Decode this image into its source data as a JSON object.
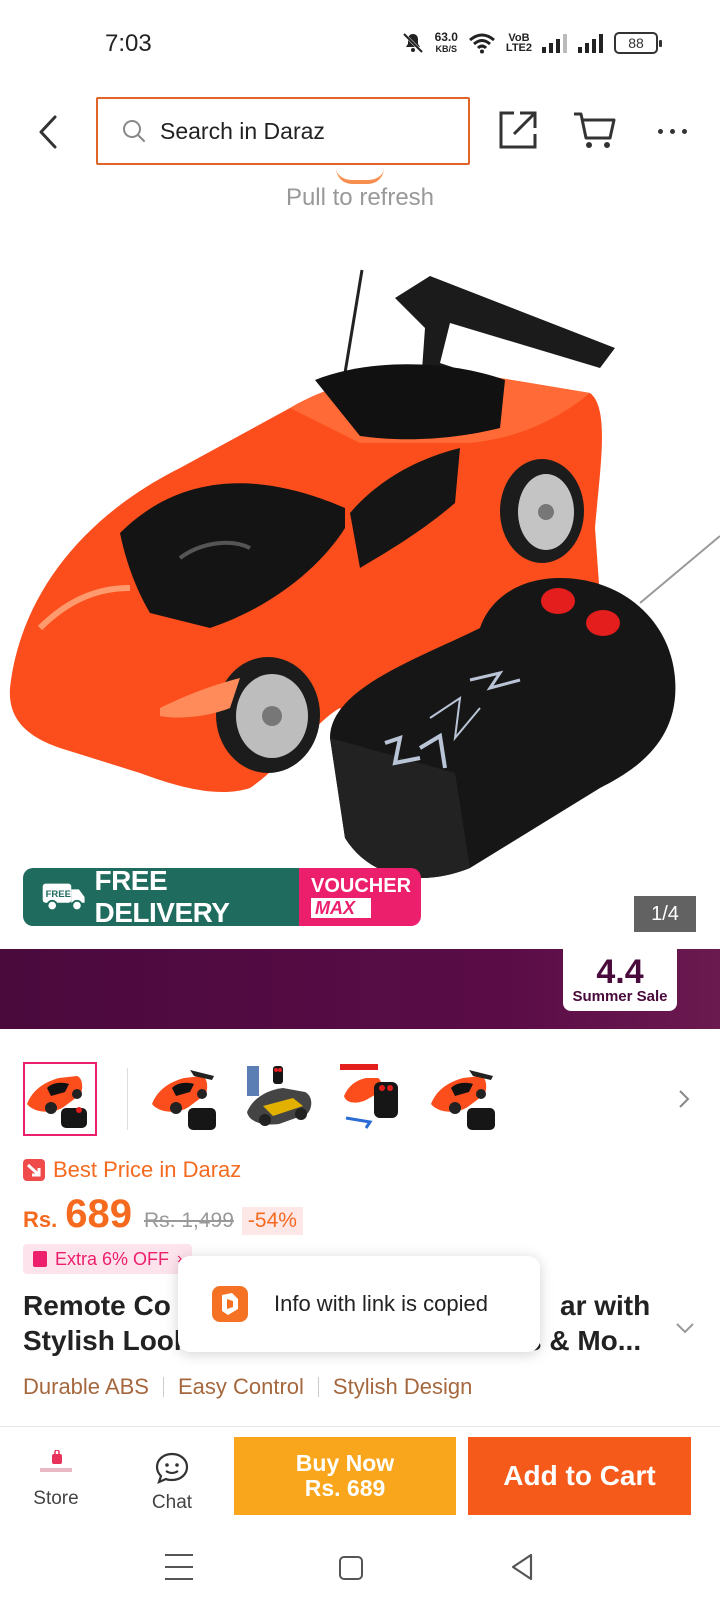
{
  "status_bar": {
    "time": "7:03",
    "net_speed_value": "63.0",
    "net_speed_unit": "KB/S",
    "volte_top": "VoB",
    "volte_bottom": "LTE2",
    "battery": "88"
  },
  "header": {
    "search_placeholder": "Search in Daraz"
  },
  "pull_to_refresh": "Pull to refresh",
  "gallery": {
    "counter": "1/4",
    "promo_free_icon_text": "FREE",
    "promo_free_label": "FREE DELIVERY",
    "promo_voucher_top": "VOUCHER",
    "promo_voucher_bottom": "MAX"
  },
  "campaign": {
    "badge_big": "4.4",
    "badge_small": "Summer Sale"
  },
  "price": {
    "best_price_label": "Best Price in Daraz",
    "currency": "Rs.",
    "amount": "689",
    "original": "Rs. 1,499",
    "discount": "-54%",
    "extra_off": "Extra 6% OFF"
  },
  "product": {
    "title_line1_left": "Remote Co",
    "title_line1_right": "ar with",
    "title_line2_left": "Stylish Look",
    "title_line2_right": "s & Mo..."
  },
  "toast": {
    "message": "Info with link is copied"
  },
  "tags": [
    "Durable ABS",
    "Easy Control",
    "Stylish Design"
  ],
  "actions": {
    "store_label": "Store",
    "chat_label": "Chat",
    "buy_now_line1": "Buy Now",
    "buy_now_line2": "Rs. 689",
    "add_to_cart": "Add to Cart"
  },
  "colors": {
    "brand_orange": "#f57224",
    "buy_now": "#f9a61c",
    "add_to_cart": "#f55a1a",
    "campaign_purple": "#4a0a3c",
    "voucher_pink": "#ec1f6d",
    "free_delivery_green": "#1f6b5e"
  }
}
